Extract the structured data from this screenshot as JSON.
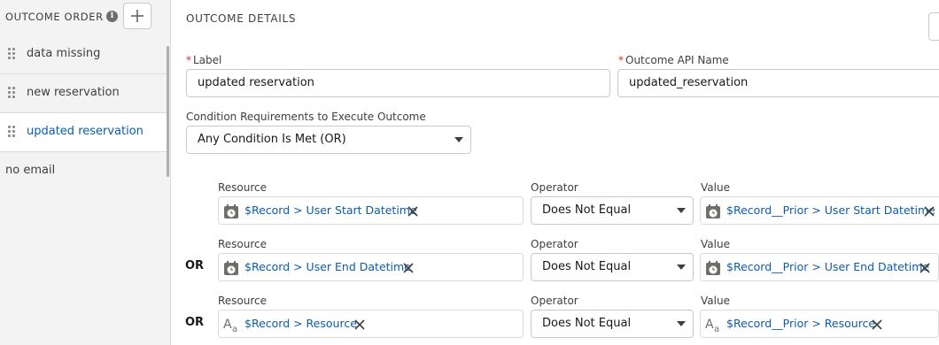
{
  "sidebar": {
    "title": "OUTCOME ORDER",
    "info_icon": "info-icon",
    "add_icon": "plus-icon",
    "items": [
      {
        "label": "data missing",
        "selected": false
      },
      {
        "label": "new reservation",
        "selected": false
      },
      {
        "label": "updated reservation",
        "selected": true
      }
    ],
    "default_item": "no email"
  },
  "details": {
    "section_title": "OUTCOME DETAILS",
    "label_field": {
      "label": "Label",
      "required_marker": "*",
      "value": "updated reservation"
    },
    "api_name_field": {
      "label": "Outcome API Name",
      "required_marker": "*",
      "value": "updated_reservation"
    },
    "condition_requirements": {
      "label": "Condition Requirements to Execute Outcome",
      "value": "Any Condition Is Met (OR)"
    },
    "conditions": [
      {
        "connector": "",
        "resource_label": "Resource",
        "resource_value": "$Record > User Start Datetime",
        "resource_icon": "datetime-icon",
        "operator_label": "Operator",
        "operator_value": "Does Not Equal",
        "value_label": "Value",
        "value_value": "$Record__Prior > User Start Datetime",
        "value_icon": "datetime-icon"
      },
      {
        "connector": "OR",
        "resource_label": "Resource",
        "resource_value": "$Record > User End Datetime",
        "resource_icon": "datetime-icon",
        "operator_label": "Operator",
        "operator_value": "Does Not Equal",
        "value_label": "Value",
        "value_value": "$Record__Prior > User End Datetime",
        "value_icon": "datetime-icon"
      },
      {
        "connector": "OR",
        "resource_label": "Resource",
        "resource_value": "$Record > Resource",
        "resource_icon": "text-icon",
        "operator_label": "Operator",
        "operator_value": "Does Not Equal",
        "value_label": "Value",
        "value_value": "$Record__Prior > Resource",
        "value_icon": "text-icon"
      }
    ]
  },
  "colors": {
    "link": "#0b5cab",
    "required": "#c23934",
    "sidebar_bg": "#f3f3f3"
  }
}
